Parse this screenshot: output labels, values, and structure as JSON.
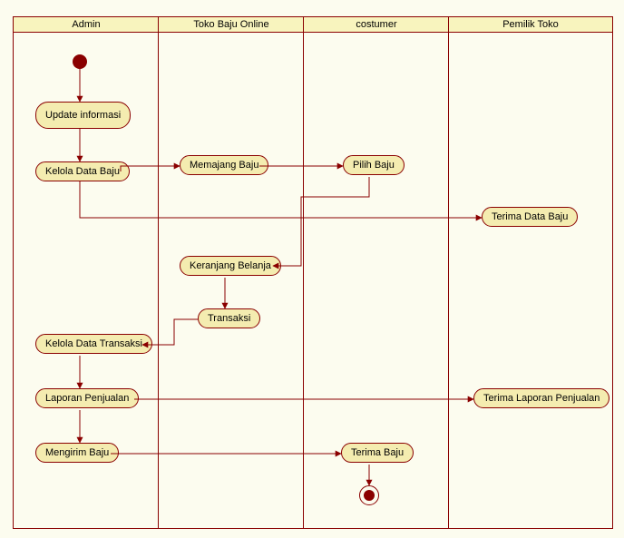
{
  "lanes": {
    "admin": "Admin",
    "shop": "Toko Baju Online",
    "customer": "costumer",
    "owner": "Pemilik Toko"
  },
  "nodes": {
    "updateInfo": "Update informasi",
    "kelolaBaju": "Kelola Data Baju",
    "memajang": "Memajang Baju",
    "pilihBaju": "Pilih Baju",
    "terimaData": "Terima Data Baju",
    "keranjang": "Keranjang Belanja",
    "transaksi": "Transaksi",
    "kelolaTransaksi": "Kelola Data Transaksi",
    "laporan": "Laporan Penjualan",
    "terimaLaporan": "Terima Laporan Penjualan",
    "mengirim": "Mengirim Baju",
    "terimaBaju": "Terima Baju"
  },
  "chart_data": {
    "type": "activity-diagram",
    "title": "",
    "swimlanes": [
      "Admin",
      "Toko Baju Online",
      "costumer",
      "Pemilik Toko"
    ],
    "nodes": [
      {
        "id": "initial",
        "lane": "Admin",
        "kind": "initial"
      },
      {
        "id": "updateInfo",
        "lane": "Admin",
        "kind": "action",
        "label": "Update informasi"
      },
      {
        "id": "kelolaBaju",
        "lane": "Admin",
        "kind": "action",
        "label": "Kelola Data Baju"
      },
      {
        "id": "memajang",
        "lane": "Toko Baju Online",
        "kind": "action",
        "label": "Memajang Baju"
      },
      {
        "id": "pilihBaju",
        "lane": "costumer",
        "kind": "action",
        "label": "Pilih Baju"
      },
      {
        "id": "terimaData",
        "lane": "Pemilik Toko",
        "kind": "action",
        "label": "Terima Data Baju"
      },
      {
        "id": "keranjang",
        "lane": "Toko Baju Online",
        "kind": "action",
        "label": "Keranjang Belanja"
      },
      {
        "id": "transaksi",
        "lane": "Toko Baju Online",
        "kind": "action",
        "label": "Transaksi"
      },
      {
        "id": "kelolaTransaksi",
        "lane": "Admin",
        "kind": "action",
        "label": "Kelola Data Transaksi"
      },
      {
        "id": "laporan",
        "lane": "Admin",
        "kind": "action",
        "label": "Laporan Penjualan"
      },
      {
        "id": "terimaLaporan",
        "lane": "Pemilik Toko",
        "kind": "action",
        "label": "Terima Laporan Penjualan"
      },
      {
        "id": "mengirim",
        "lane": "Admin",
        "kind": "action",
        "label": "Mengirim Baju"
      },
      {
        "id": "terimaBaju",
        "lane": "costumer",
        "kind": "action",
        "label": "Terima Baju"
      },
      {
        "id": "final",
        "lane": "costumer",
        "kind": "final"
      }
    ],
    "edges": [
      {
        "from": "initial",
        "to": "updateInfo"
      },
      {
        "from": "updateInfo",
        "to": "kelolaBaju"
      },
      {
        "from": "kelolaBaju",
        "to": "memajang"
      },
      {
        "from": "memajang",
        "to": "pilihBaju"
      },
      {
        "from": "kelolaBaju",
        "to": "terimaData"
      },
      {
        "from": "pilihBaju",
        "to": "keranjang"
      },
      {
        "from": "keranjang",
        "to": "transaksi"
      },
      {
        "from": "transaksi",
        "to": "kelolaTransaksi"
      },
      {
        "from": "kelolaTransaksi",
        "to": "laporan"
      },
      {
        "from": "laporan",
        "to": "terimaLaporan"
      },
      {
        "from": "laporan",
        "to": "mengirim"
      },
      {
        "from": "mengirim",
        "to": "terimaBaju"
      },
      {
        "from": "terimaBaju",
        "to": "final"
      }
    ]
  }
}
